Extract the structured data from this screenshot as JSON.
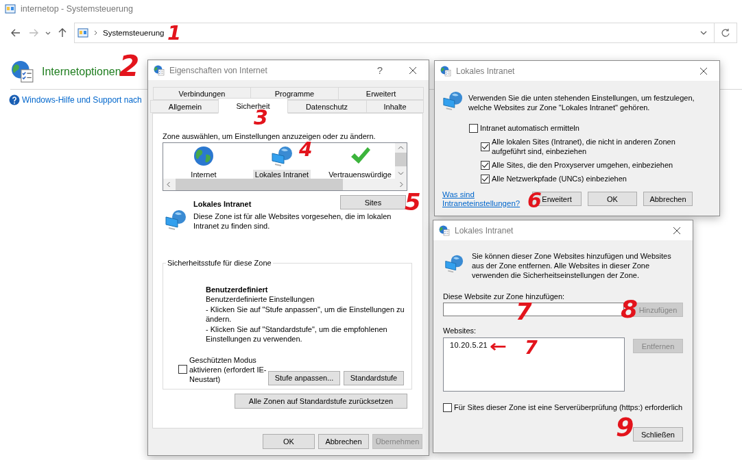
{
  "window": {
    "title": "internetop - Systemsteuerung"
  },
  "address_bar": {
    "location": "Systemsteuerung"
  },
  "heading": "Internetoptionen",
  "help_link": "Windows-Hilfe und Support nach",
  "properties_dialog": {
    "title": "Eigenschaften von Internet",
    "help_button": "?",
    "tab_rows": [
      [
        {
          "label": "Verbindungen",
          "selected": false
        },
        {
          "label": "Programme",
          "selected": false
        },
        {
          "label": "Erweitert",
          "selected": false
        }
      ],
      [
        {
          "label": "Allgemein",
          "selected": false
        },
        {
          "label": "Sicherheit",
          "selected": true
        },
        {
          "label": "Datenschutz",
          "selected": false
        },
        {
          "label": "Inhalte",
          "selected": false
        }
      ]
    ],
    "zone_prompt": "Zone auswählen, um Einstellungen anzuzeigen oder zu ändern.",
    "zones": [
      {
        "label": "Internet",
        "kind": "globe",
        "selected": false
      },
      {
        "label": "Lokales Intranet",
        "kind": "intranet",
        "selected": true
      },
      {
        "label": "Vertrauenswürdige",
        "kind": "trusted",
        "selected": false
      }
    ],
    "sites_button": "Sites",
    "zone_title": "Lokales Intranet",
    "zone_description": "Diese Zone ist für alle Websites vorgesehen, die im lokalen Intranet zu finden sind.",
    "security_level": {
      "legend": "Sicherheitsstufe für diese Zone",
      "title": "Benutzerdefiniert",
      "lines": [
        "Benutzerdefinierte Einstellungen",
        "- Klicken Sie auf \"Stufe anpassen\", um die Einstellungen zu ändern.",
        "- Klicken Sie auf \"Standardstufe\", um die empfohlenen Einstellungen zu verwenden."
      ],
      "protected_mode": {
        "label": "Geschützten Modus aktivieren (erfordert IE-Neustart)",
        "checked": false
      },
      "buttons": [
        {
          "label": "Stufe anpassen..."
        },
        {
          "label": "Standardstufe"
        }
      ]
    },
    "reset_button": "Alle Zonen auf Standardstufe zurücksetzen",
    "buttons": [
      {
        "label": "OK",
        "disabled": false
      },
      {
        "label": "Abbrechen",
        "disabled": false
      },
      {
        "label": "Übernehmen",
        "disabled": true
      }
    ]
  },
  "intranet_dialog": {
    "title": "Lokales Intranet",
    "intro": "Verwenden Sie die unten stehenden Einstellungen, um festzulegen, welche Websites zur Zone \"Lokales Intranet\" gehören.",
    "options": [
      {
        "label": "Intranet automatisch ermitteln",
        "checked": false,
        "children": [
          {
            "label": "Alle lokalen Sites (Intranet), die nicht in anderen Zonen aufgeführt sind, einbeziehen",
            "checked": true
          },
          {
            "label": "Alle Sites, die den Proxyserver umgehen, einbeziehen",
            "checked": true
          },
          {
            "label": "Alle Netzwerkpfade (UNCs) einbeziehen",
            "checked": true
          }
        ]
      }
    ],
    "help_link": "Was sind Intraneteinstellungen?",
    "buttons": [
      {
        "label": "Erweitert"
      },
      {
        "label": "OK"
      },
      {
        "label": "Abbrechen"
      }
    ]
  },
  "sites_dialog": {
    "title": "Lokales Intranet",
    "intro": "Sie können dieser Zone Websites hinzufügen und Websites aus der Zone entfernen. Alle Websites in dieser Zone verwenden die Sicherheitseinstellungen der Zone.",
    "add_label": "Diese Website zur Zone hinzufügen:",
    "add_button": {
      "label": "Hinzufügen",
      "disabled": true
    },
    "list_label": "Websites:",
    "websites": [
      "10.20.5.21"
    ],
    "remove_button": {
      "label": "Entfernen",
      "disabled": true
    },
    "https_required": {
      "label": "Für Sites dieser Zone ist eine Serverüberprüfung (https:) erforderlich",
      "checked": false
    },
    "close_button": "Schließen"
  },
  "annotations": [
    {
      "text": "1",
      "kind": "number"
    },
    {
      "text": "2",
      "kind": "number"
    },
    {
      "text": "3",
      "kind": "number"
    },
    {
      "text": "4",
      "kind": "number"
    },
    {
      "text": "5",
      "kind": "number"
    },
    {
      "text": "6",
      "kind": "number"
    },
    {
      "text": "7",
      "kind": "number"
    },
    {
      "text": "8",
      "kind": "number"
    },
    {
      "text": "←",
      "kind": "arrow"
    },
    {
      "text": "7",
      "kind": "number"
    },
    {
      "text": "9",
      "kind": "number"
    }
  ]
}
